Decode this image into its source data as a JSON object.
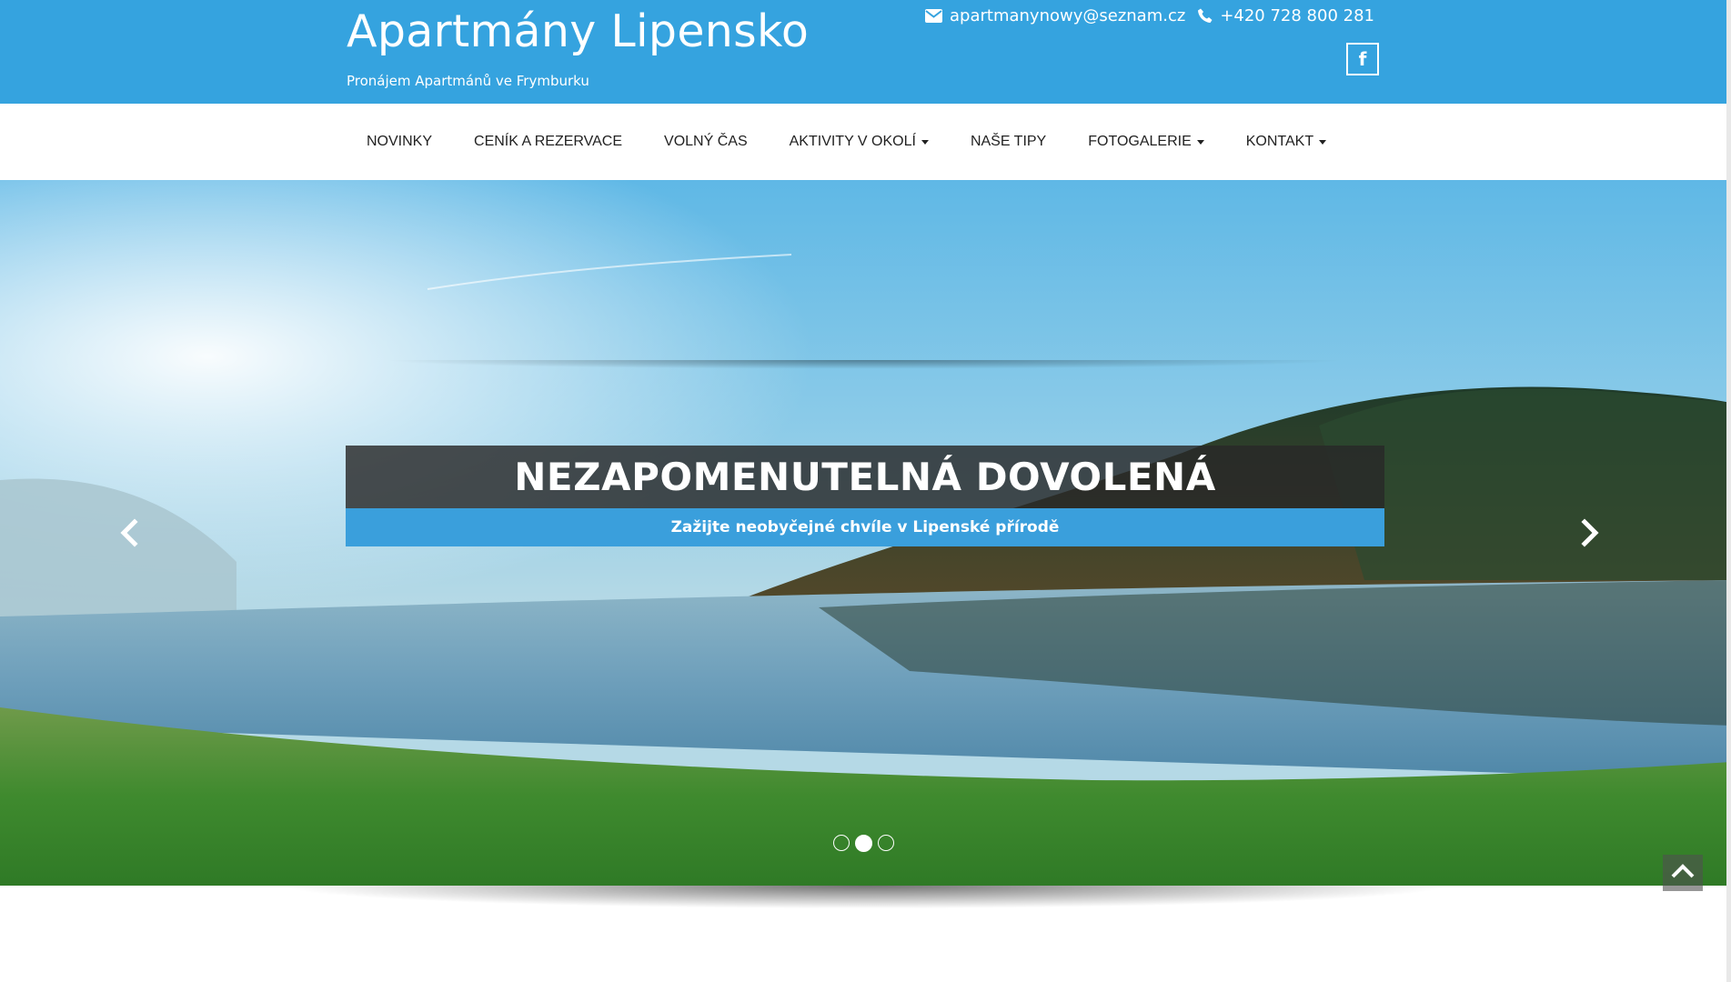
{
  "header": {
    "title": "Apartmány Lipensko",
    "subtitle": "Pronájem Apartmánů ve Frymburku",
    "email": "apartmanynowy@seznam.cz",
    "phone": "+420 728 800 281",
    "facebook_label": "f",
    "background_color": "#35a3df"
  },
  "nav": {
    "items": [
      {
        "label": "NOVINKY",
        "dropdown": false
      },
      {
        "label": "CENÍK A REZERVACE",
        "dropdown": false
      },
      {
        "label": "VOLNÝ ČAS",
        "dropdown": false
      },
      {
        "label": "AKTIVITY V OKOLÍ",
        "dropdown": true
      },
      {
        "label": "NAŠE TIPY",
        "dropdown": false
      },
      {
        "label": "FOTOGALERIE",
        "dropdown": true
      },
      {
        "label": "KONTAKT",
        "dropdown": true
      }
    ]
  },
  "carousel": {
    "caption_title": "NEZAPOMENUTELNÁ DOVOLENÁ",
    "caption_subtitle": "Zažijte neobyčejné chvíle v Lipenské přírodě",
    "slide_count": 3,
    "active_slide": 2
  },
  "icons": {
    "email": "envelope-icon",
    "phone": "phone-icon",
    "facebook": "facebook-icon",
    "prev": "chevron-left-icon",
    "next": "chevron-right-icon",
    "scroll_top": "chevron-up-icon"
  }
}
